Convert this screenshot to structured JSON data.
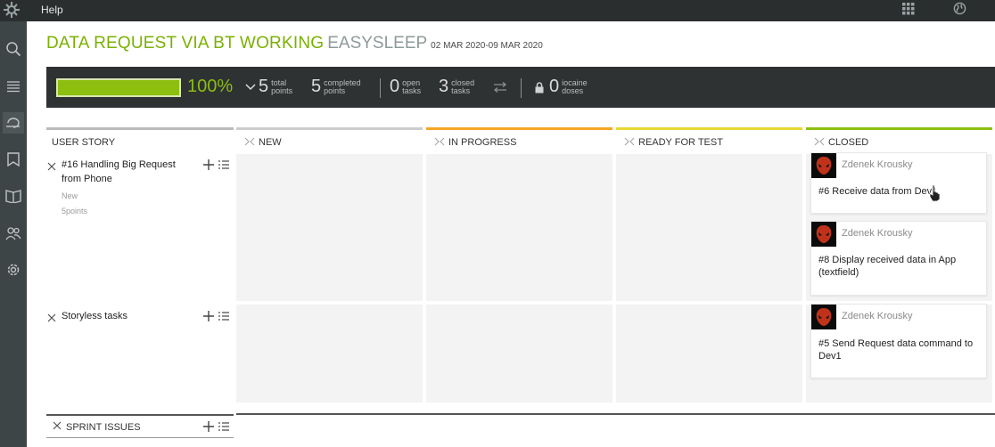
{
  "topbar": {
    "help_label": "Help",
    "logo_icon": "logo-icon",
    "apps_icon": "grid-icon",
    "globe_icon": "globe-icon"
  },
  "sidebar": {
    "items": [
      "search-icon",
      "backlog-icon",
      "kanban-icon",
      "issues-icon",
      "wiki-icon",
      "team-icon",
      "settings-icon"
    ]
  },
  "header": {
    "project": "DATA REQUEST VIA BT WORKING",
    "sprint": "EASYSLEEP",
    "dates": "02 MAR 2020-09 MAR 2020"
  },
  "summary": {
    "progress_percent": 100,
    "percent_label": "100%",
    "total_points": "5",
    "total_points_label_1": "total",
    "total_points_label_2": "points",
    "completed_points": "5",
    "completed_points_label_1": "completed",
    "completed_points_label_2": "points",
    "open_tasks": "0",
    "open_tasks_label_1": "open",
    "open_tasks_label_2": "tasks",
    "closed_tasks": "3",
    "closed_tasks_label_1": "closed",
    "closed_tasks_label_2": "tasks",
    "iocaine": "0",
    "iocaine_label_1": "iocaine",
    "iocaine_label_2": "doses",
    "colors": {
      "bar": "#8cbf0f",
      "bg": "#2f3233"
    }
  },
  "columns": {
    "user_story": "USER STORY",
    "new": "NEW",
    "in_progress": "IN PROGRESS",
    "ready_for_test": "READY FOR TEST",
    "closed": "CLOSED",
    "colors": {
      "new": "#cccccc",
      "in_progress": "#f5a623",
      "ready": "#e6d733",
      "closed": "#8cbf0f"
    }
  },
  "stories": [
    {
      "title": "#16 Handling Big Request from Phone",
      "status": "New",
      "points": "5points"
    },
    {
      "title": "Storyless tasks"
    }
  ],
  "cards": [
    {
      "user": "Zdenek Krousky",
      "title": "#6 Receive data from Dev1"
    },
    {
      "user": "Zdenek Krousky",
      "title": "#8 Display received data in App (textfield)"
    },
    {
      "user": "Zdenek Krousky",
      "title": "#5 Send Request data command to Dev1"
    }
  ],
  "sprint_issues": {
    "label": "SPRINT ISSUES"
  }
}
